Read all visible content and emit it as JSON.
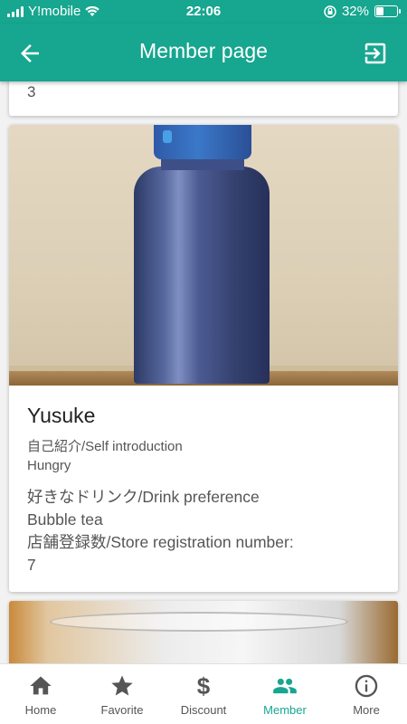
{
  "status_bar": {
    "carrier": "Y!mobile",
    "time": "22:06",
    "battery_percent": "32%",
    "battery_level": 0.32
  },
  "app_bar": {
    "title": "Member page",
    "back_icon": "arrow-left-icon",
    "exit_icon": "exit-to-app-icon",
    "color": "#17a68f"
  },
  "cards": {
    "previous": {
      "store_count": "3"
    },
    "current": {
      "name": "Yusuke",
      "intro_label": "自己紹介/Self introduction",
      "intro_value": "Hungry",
      "drink_label": "好きなドリンク/Drink preference",
      "drink_value": "Bubble tea",
      "store_label": "店舗登録数/Store registration number:",
      "store_value": "7"
    }
  },
  "bottom_nav": {
    "items": [
      {
        "label": "Home",
        "icon": "home-icon"
      },
      {
        "label": "Favorite",
        "icon": "star-icon"
      },
      {
        "label": "Discount",
        "icon": "dollar-icon"
      },
      {
        "label": "Member",
        "icon": "people-icon",
        "active": true
      },
      {
        "label": "More",
        "icon": "info-icon"
      }
    ],
    "active_color": "#17a68f"
  }
}
